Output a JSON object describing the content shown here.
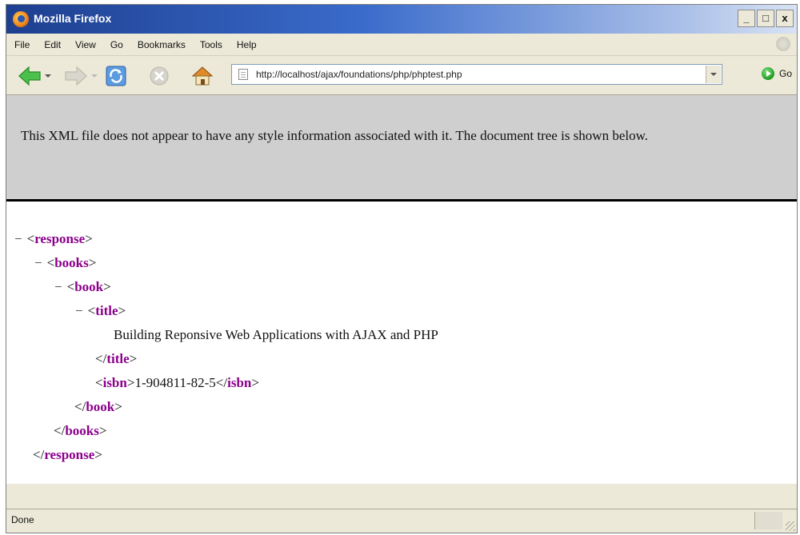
{
  "window": {
    "title": "Mozilla Firefox",
    "controls": {
      "minimize": "_",
      "maximize": "□",
      "close": "x"
    }
  },
  "menu": [
    "File",
    "Edit",
    "View",
    "Go",
    "Bookmarks",
    "Tools",
    "Help"
  ],
  "navigation": {
    "url": "http://localhost/ajax/foundations/php/phptest.php",
    "go_label": "Go"
  },
  "notice": "This XML file does not appear to have any style information associated with it. The document tree is shown below.",
  "tree": {
    "collapse_glyph": "−",
    "response": "response",
    "books": "books",
    "book": "book",
    "title": "title",
    "title_text": "Building Reponsive Web Applications with AJAX and PHP",
    "isbn": "isbn",
    "isbn_text": "1-904811-82-5"
  },
  "status": {
    "text": "Done"
  },
  "colors": {
    "tag": "#8b008b",
    "notice_bg": "#cfcfcf",
    "chrome": "#ece9d8"
  }
}
